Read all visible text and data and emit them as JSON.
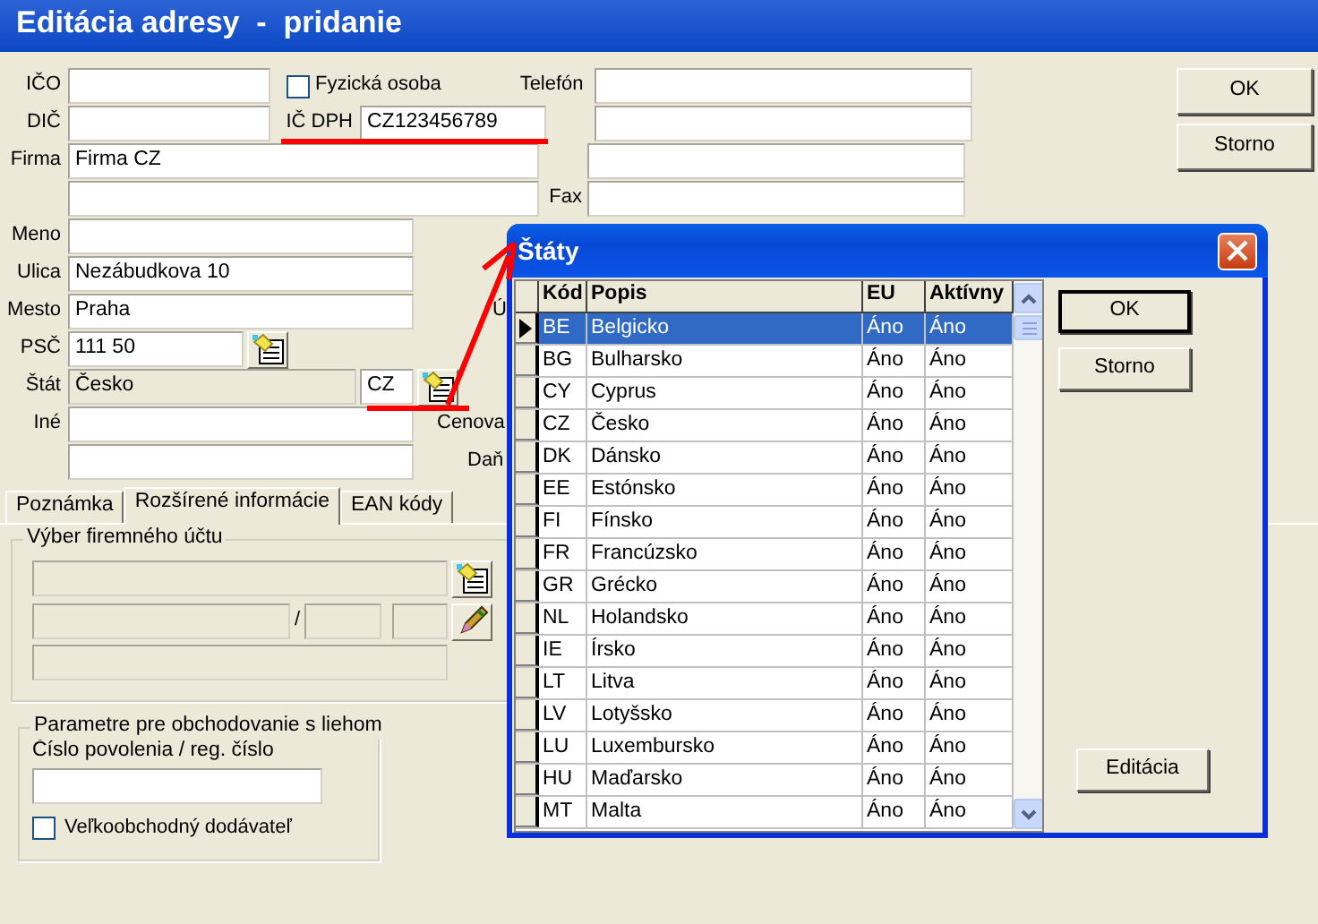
{
  "window": {
    "title": "Editácia adresy  -  pridanie"
  },
  "address": {
    "ico_label": "IČO",
    "dic_label": "DIČ",
    "physical_person": {
      "label": "Fyzická osoba",
      "checked": false
    },
    "vat_label": "IČ DPH",
    "vat_value": "CZ123456789",
    "phone_label": "Telefón",
    "fax_label": "Fax",
    "company_label": "Firma",
    "company_value": "Firma CZ",
    "name_label": "Meno",
    "street_label": "Ulica",
    "street_value": "Nezábudkova 10",
    "city_label": "Mesto",
    "city_value": "Praha",
    "zip_label": "PSČ",
    "zip_value": "111 50",
    "country_label": "Štát",
    "country_value": "Česko",
    "country_code": "CZ",
    "other_label": "Iné",
    "partial_labels": [
      "Ú",
      "Cenova",
      "Daň"
    ]
  },
  "buttons": [
    "OK",
    "Storno"
  ],
  "tabs": [
    {
      "label": "Poznámka",
      "selected": false
    },
    {
      "label": "Rozšírené informácie",
      "selected": true
    },
    {
      "label": "EAN kódy",
      "selected": false
    }
  ],
  "account_group": {
    "title": "Výber firemného účtu",
    "separator": "/"
  },
  "liquor_group": {
    "title": "Parametre pre obchodovanie s liehom",
    "field_label": "Číslo povolenia / reg. číslo",
    "wholesaler": {
      "label": "Veľkoobchodný dodávateľ",
      "checked": false
    }
  },
  "dialog": {
    "title": "Štáty",
    "columns": [
      "Kód",
      "Popis",
      "EU",
      "Aktívny"
    ],
    "rows": [
      {
        "cells": [
          "BE",
          "Belgicko",
          "Áno",
          "Áno"
        ],
        "selected": true
      },
      {
        "cells": [
          "BG",
          "Bulharsko",
          "Áno",
          "Áno"
        ],
        "selected": false
      },
      {
        "cells": [
          "CY",
          "Cyprus",
          "Áno",
          "Áno"
        ],
        "selected": false
      },
      {
        "cells": [
          "CZ",
          "Česko",
          "Áno",
          "Áno"
        ],
        "selected": false
      },
      {
        "cells": [
          "DK",
          "Dánsko",
          "Áno",
          "Áno"
        ],
        "selected": false
      },
      {
        "cells": [
          "EE",
          "Estónsko",
          "Áno",
          "Áno"
        ],
        "selected": false
      },
      {
        "cells": [
          "FI",
          "Fínsko",
          "Áno",
          "Áno"
        ],
        "selected": false
      },
      {
        "cells": [
          "FR",
          "Francúzsko",
          "Áno",
          "Áno"
        ],
        "selected": false
      },
      {
        "cells": [
          "GR",
          "Grécko",
          "Áno",
          "Áno"
        ],
        "selected": false
      },
      {
        "cells": [
          "NL",
          "Holandsko",
          "Áno",
          "Áno"
        ],
        "selected": false
      },
      {
        "cells": [
          "IE",
          "Írsko",
          "Áno",
          "Áno"
        ],
        "selected": false
      },
      {
        "cells": [
          "LT",
          "Litva",
          "Áno",
          "Áno"
        ],
        "selected": false
      },
      {
        "cells": [
          "LV",
          "Lotyšsko",
          "Áno",
          "Áno"
        ],
        "selected": false
      },
      {
        "cells": [
          "LU",
          "Luxembursko",
          "Áno",
          "Áno"
        ],
        "selected": false
      },
      {
        "cells": [
          "HU",
          "Maďarsko",
          "Áno",
          "Áno"
        ],
        "selected": false
      },
      {
        "cells": [
          "MT",
          "Malta",
          "Áno",
          "Áno"
        ],
        "selected": false
      }
    ],
    "buttons": [
      "OK",
      "Storno"
    ],
    "edit_button": "Editácia"
  }
}
